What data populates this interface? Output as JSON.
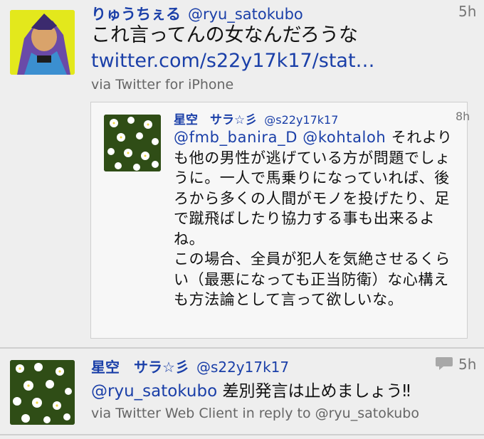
{
  "tweets": [
    {
      "display_name": "りゅうちぇる",
      "handle": "@ryu_satokubo",
      "time": "5h",
      "text": "これ言ってんの女なんだろうな",
      "link": "twitter.com/s22y17k17/stat…",
      "via": "via Twitter for iPhone",
      "avatar_icon": "manga-character-avatar",
      "quoted": {
        "display_name": "星空　サラ☆彡",
        "handle": "@s22y17k17",
        "time": "8h",
        "mentions": "@fmb_banira_D @kohtaloh",
        "text": " それよりも他の男性が逃げている方が問題でしょうに。一人で馬乗りになっていれば、後ろから多くの人間がモノを投げたり、足で蹴飛ばしたり協力する事も出来るよね。\nこの場合、全員が犯人を気絶させるくらい（最悪になっても正当防衛）な心構えも方法論として言って欲しいな。",
        "avatar_icon": "white-flowers-avatar"
      }
    },
    {
      "display_name": "星空　サラ☆彡",
      "handle": "@s22y17k17",
      "time": "5h",
      "mention": "@ryu_satokubo",
      "text": " 差別発言は止めましょう‼",
      "via": "via Twitter Web Client in reply to @ryu_satokubo",
      "avatar_icon": "white-flowers-avatar",
      "reply_icon": "speech-bubble-icon"
    }
  ],
  "colors": {
    "link": "#1a3fa8",
    "background": "#eeeeee",
    "meta": "#666666"
  }
}
